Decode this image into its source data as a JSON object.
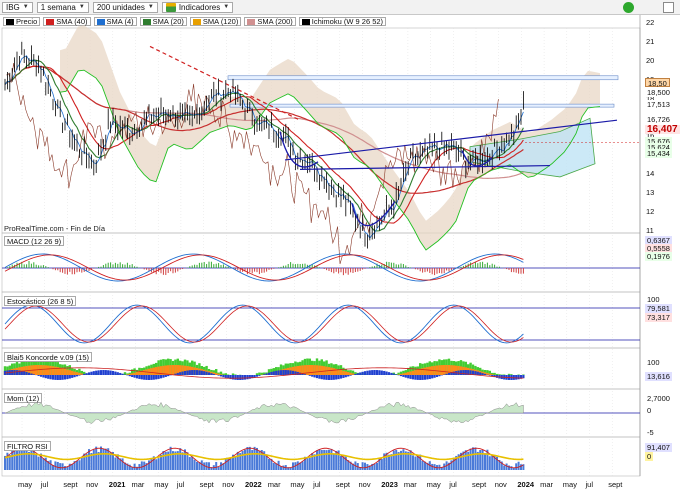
{
  "toolbar": {
    "symbol": "IBG",
    "period": "1 semana",
    "units": "200 unidades",
    "indicators_label": "Indicadores"
  },
  "legend": [
    {
      "label": "Precio",
      "color": "#000000"
    },
    {
      "label": "SMA (40)",
      "color": "#d02020"
    },
    {
      "label": "SMA (4)",
      "color": "#1f6fd0"
    },
    {
      "label": "SMA (20)",
      "color": "#2f7d2f"
    },
    {
      "label": "SMA (120)",
      "color": "#e8a000"
    },
    {
      "label": "SMA (200)",
      "color": "#d09090"
    },
    {
      "label": "Ichimoku (W 9 26 52)",
      "color": "#000000"
    }
  ],
  "source_label": "ProRealTime.com - Fin de Día",
  "price_axis": {
    "ticks": [
      "22",
      "21",
      "20",
      "19",
      "18",
      "17",
      "16",
      "15",
      "14",
      "13",
      "12",
      "11"
    ],
    "boxes": [
      {
        "text": "18,50",
        "bg": "#ffd7a8"
      },
      {
        "text": "18,500",
        "bg": "#ffffff"
      },
      {
        "text": "17,513",
        "bg": "#ffffff"
      },
      {
        "text": "16,726",
        "bg": "#ffffff"
      },
      {
        "text": "16,407",
        "bg": "#ffe4e4"
      },
      {
        "text": "15,676",
        "bg": "#e8ffe8"
      },
      {
        "text": "15,624",
        "bg": "#e8ffe8"
      },
      {
        "text": "15,434",
        "bg": "#e8ffe8"
      }
    ]
  },
  "panels": {
    "macd": {
      "label": "MACD (12 26 9)",
      "values": [
        "0,6367",
        "0,5558",
        "0,1976"
      ]
    },
    "stoch": {
      "label": "Estocástico (26 8 5)",
      "values": [
        "100",
        "79,581",
        "73,317"
      ]
    },
    "blai5": {
      "label": "Blai5 Koncorde v.09 (15)",
      "values": [
        "100",
        "13,616"
      ]
    },
    "mom": {
      "label": "Mom (12)",
      "values": [
        "2,7000",
        "0",
        "-5"
      ]
    },
    "rsi": {
      "label": "FILTRO RSI",
      "values": [
        "91,407",
        "0"
      ]
    }
  },
  "x_axis": [
    "may",
    "jul",
    "sept",
    "nov",
    "2021",
    "mar",
    "may",
    "jul",
    "sept",
    "nov",
    "2022",
    "mar",
    "may",
    "jul",
    "sept",
    "nov",
    "2023",
    "mar",
    "may",
    "jul",
    "sept",
    "nov",
    "2024",
    "mar",
    "may",
    "jul",
    "sept"
  ]
}
